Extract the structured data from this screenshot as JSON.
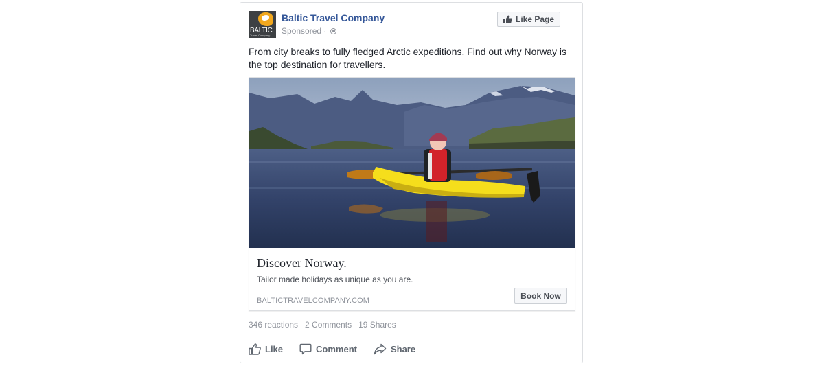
{
  "page": {
    "name": "Baltic Travel Company",
    "sponsored": "Sponsored",
    "separator": "·",
    "logo_text": "BALTIC",
    "logo_subtext": "Travel Company",
    "like_page_label": "Like Page"
  },
  "post": {
    "text": "From city breaks to fully fledged Arctic expeditions. Find out why Norway is the top destination for travellers."
  },
  "ad": {
    "headline": "Discover Norway.",
    "description": "Tailor made holidays as unique as you are.",
    "domain": "BALTICTRAVELCOMPANY.COM",
    "cta_label": "Book Now"
  },
  "stats": {
    "reactions": "346 reactions",
    "comments": "2 Comments",
    "shares": "19 Shares"
  },
  "actions": {
    "like": "Like",
    "comment": "Comment",
    "share": "Share"
  },
  "icons": {
    "thumb": "thumbs-up-icon",
    "comment": "speech-bubble-icon",
    "share": "share-arrow-icon",
    "privacy": "globe-icon"
  },
  "colors": {
    "link_blue": "#365899",
    "muted": "#90949c",
    "action_gray": "#606770",
    "kayak_yellow": "#f5de1c",
    "lifejacket_red": "#d2232a"
  }
}
